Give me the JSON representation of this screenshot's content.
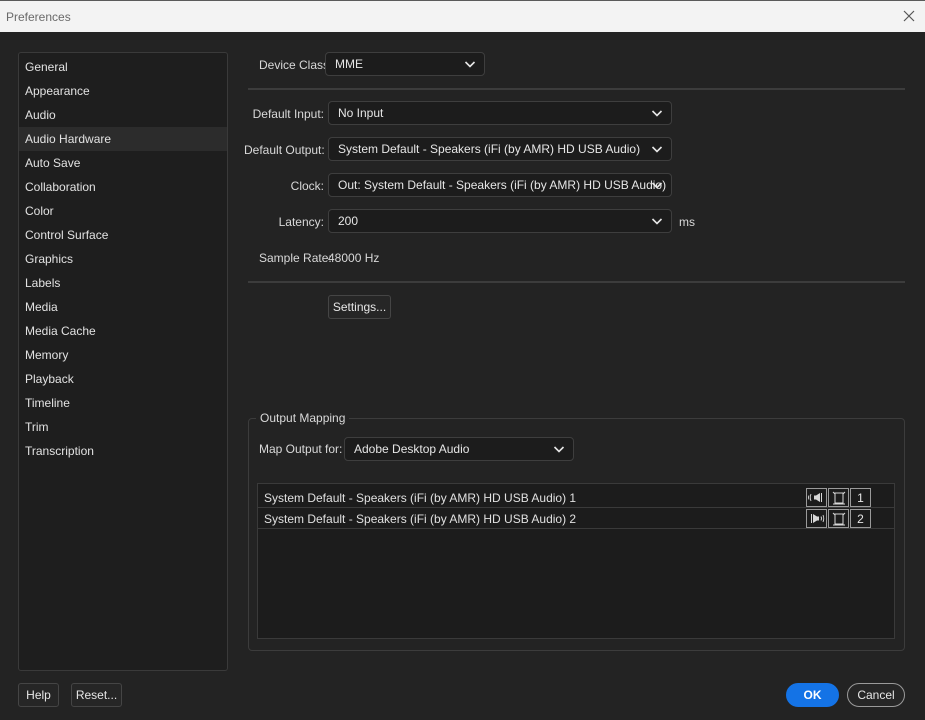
{
  "window": {
    "title": "Preferences"
  },
  "sidebar": {
    "items": [
      {
        "label": "General"
      },
      {
        "label": "Appearance"
      },
      {
        "label": "Audio"
      },
      {
        "label": "Audio Hardware"
      },
      {
        "label": "Auto Save"
      },
      {
        "label": "Collaboration"
      },
      {
        "label": "Color"
      },
      {
        "label": "Control Surface"
      },
      {
        "label": "Graphics"
      },
      {
        "label": "Labels"
      },
      {
        "label": "Media"
      },
      {
        "label": "Media Cache"
      },
      {
        "label": "Memory"
      },
      {
        "label": "Playback"
      },
      {
        "label": "Timeline"
      },
      {
        "label": "Trim"
      },
      {
        "label": "Transcription"
      }
    ],
    "selected": "Audio Hardware"
  },
  "form": {
    "device_class": {
      "label": "Device Class:",
      "value": "MME"
    },
    "default_input": {
      "label": "Default Input:",
      "value": "No Input"
    },
    "default_output": {
      "label": "Default Output:",
      "value": "System Default - Speakers (iFi (by AMR) HD USB Audio)"
    },
    "clock": {
      "label": "Clock:",
      "value": "Out: System Default - Speakers (iFi (by AMR) HD USB Audio)"
    },
    "latency": {
      "label": "Latency:",
      "value": "200",
      "unit": "ms"
    },
    "sample_rate": {
      "label": "Sample Rate:",
      "value": "48000 Hz"
    },
    "settings_button": "Settings..."
  },
  "output_mapping": {
    "title": "Output Mapping",
    "map_output_label": "Map Output for:",
    "map_output_value": "Adobe Desktop Audio",
    "rows": [
      {
        "name": "System Default - Speakers (iFi (by AMR) HD USB Audio) 1",
        "channel": "1",
        "icon": "speaker-left-icon"
      },
      {
        "name": "System Default - Speakers (iFi (by AMR) HD USB Audio) 2",
        "channel": "2",
        "icon": "speaker-right-icon"
      }
    ]
  },
  "footer": {
    "help": "Help",
    "reset": "Reset...",
    "ok": "OK",
    "cancel": "Cancel"
  },
  "colors": {
    "background": "#232323",
    "panel": "#1e1e1e",
    "accent": "#1473e6",
    "titlebar": "#f3f3f3"
  }
}
